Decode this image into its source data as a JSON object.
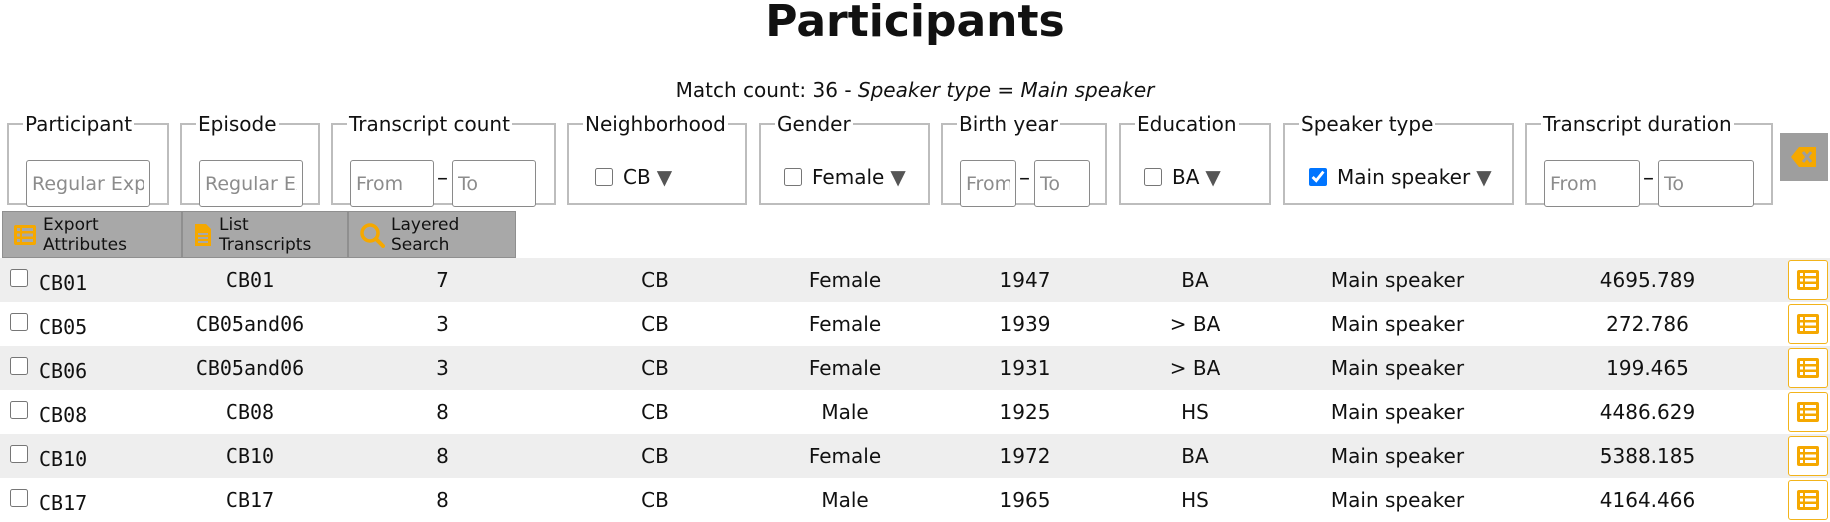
{
  "page": {
    "title": "Participants",
    "match_label": "Match count: 36 - ",
    "match_filter_attr": "Speaker type",
    "match_filter_eq": " = ",
    "match_filter_value": "Main speaker"
  },
  "filters": {
    "participant": {
      "legend": "Participant",
      "placeholder": "Regular Expression"
    },
    "episode": {
      "legend": "Episode",
      "placeholder": "Regular Expression"
    },
    "transcript_count": {
      "legend": "Transcript count",
      "from_placeholder": "From",
      "to_placeholder": "To"
    },
    "neighborhood": {
      "legend": "Neighborhood",
      "value": "CB",
      "checked": false
    },
    "gender": {
      "legend": "Gender",
      "value": "Female",
      "checked": false
    },
    "birth_year": {
      "legend": "Birth year",
      "from_placeholder": "From",
      "to_placeholder": "To"
    },
    "education": {
      "legend": "Education",
      "value": "BA",
      "checked": false
    },
    "speaker_type": {
      "legend": "Speaker type",
      "value": "Main speaker",
      "checked": true
    },
    "transcript_duration": {
      "legend": "Transcript duration",
      "from_placeholder": "From",
      "to_placeholder": "To"
    },
    "dash": "–",
    "caret": "▼"
  },
  "toolbar": {
    "export_label": "Export Attributes",
    "list_label": "List Transcripts",
    "search_label": "Layered Search"
  },
  "colors": {
    "accent": "#f5a800",
    "row_alt": "#eeeeee",
    "button_grey": "#a8a8a8"
  },
  "rows": [
    {
      "participant": "CB01",
      "episode": "CB01",
      "transcript_count": "7",
      "neighborhood": "CB",
      "gender": "Female",
      "birth_year": "1947",
      "education": "BA",
      "speaker_type": "Main speaker",
      "duration": "4695.789"
    },
    {
      "participant": "CB05",
      "episode": "CB05and06",
      "transcript_count": "3",
      "neighborhood": "CB",
      "gender": "Female",
      "birth_year": "1939",
      "education": "> BA",
      "speaker_type": "Main speaker",
      "duration": "272.786"
    },
    {
      "participant": "CB06",
      "episode": "CB05and06",
      "transcript_count": "3",
      "neighborhood": "CB",
      "gender": "Female",
      "birth_year": "1931",
      "education": "> BA",
      "speaker_type": "Main speaker",
      "duration": "199.465"
    },
    {
      "participant": "CB08",
      "episode": "CB08",
      "transcript_count": "8",
      "neighborhood": "CB",
      "gender": "Male",
      "birth_year": "1925",
      "education": "HS",
      "speaker_type": "Main speaker",
      "duration": "4486.629"
    },
    {
      "participant": "CB10",
      "episode": "CB10",
      "transcript_count": "8",
      "neighborhood": "CB",
      "gender": "Female",
      "birth_year": "1972",
      "education": "BA",
      "speaker_type": "Main speaker",
      "duration": "5388.185"
    },
    {
      "participant": "CB17",
      "episode": "CB17",
      "transcript_count": "8",
      "neighborhood": "CB",
      "gender": "Male",
      "birth_year": "1965",
      "education": "HS",
      "speaker_type": "Main speaker",
      "duration": "4164.466"
    }
  ]
}
